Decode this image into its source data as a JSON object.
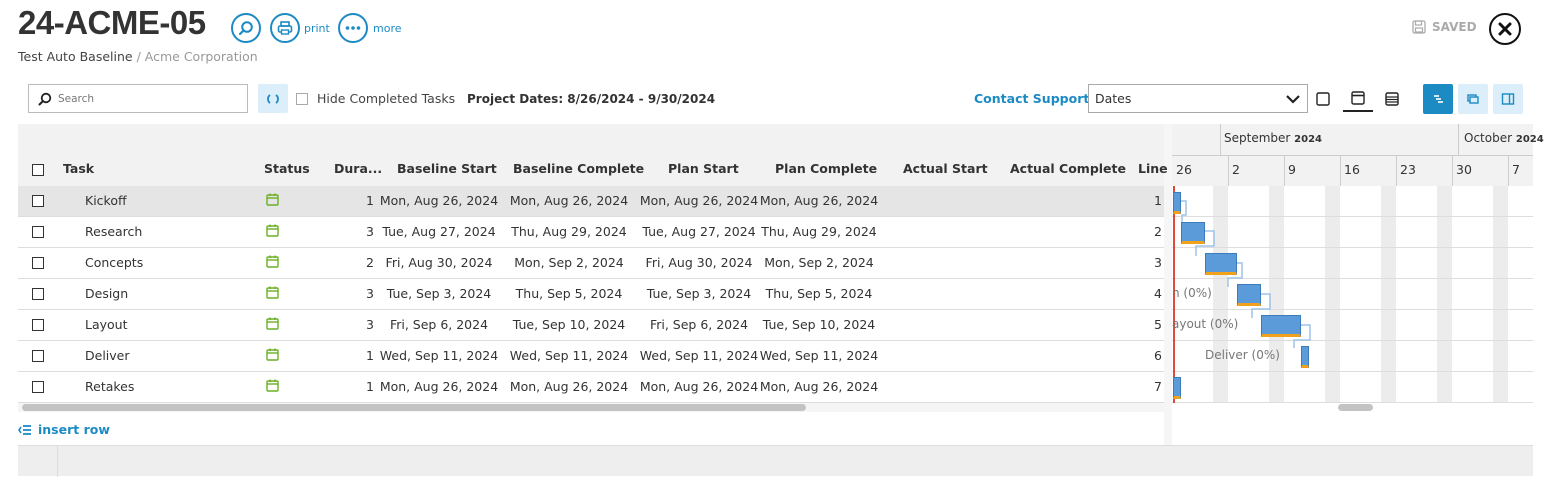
{
  "header": {
    "title": "24-ACME-05",
    "baseline": "Test Auto Baseline",
    "separator": "/",
    "organization": "Acme Corporation",
    "print_label": "print",
    "more_label": "more",
    "saved_label": "SAVED"
  },
  "toolbar": {
    "search_placeholder": "Search",
    "hide_completed_label": "Hide Completed Tasks",
    "project_dates": "Project Dates: 8/26/2024 - 9/30/2024",
    "contact_support": "Contact Support",
    "dates_select_value": "Dates",
    "insert_row": "insert row"
  },
  "columns": [
    "Task",
    "Status",
    "Dura...",
    "Baseline Start",
    "Baseline Complete",
    "Plan Start",
    "Plan Complete",
    "Actual Start",
    "Actual Complete",
    "Line"
  ],
  "rows": [
    {
      "task": "Kickoff",
      "duration": "1",
      "baseline_start": "Mon, Aug 26, 2024",
      "baseline_complete": "Mon, Aug 26, 2024",
      "plan_start": "Mon, Aug 26, 2024",
      "plan_complete": "Mon, Aug 26, 2024",
      "actual_start": "",
      "actual_complete": "",
      "line": "1",
      "selected": true
    },
    {
      "task": "Research",
      "duration": "3",
      "baseline_start": "Tue, Aug 27, 2024",
      "baseline_complete": "Thu, Aug 29, 2024",
      "plan_start": "Tue, Aug 27, 2024",
      "plan_complete": "Thu, Aug 29, 2024",
      "actual_start": "",
      "actual_complete": "",
      "line": "2",
      "selected": false
    },
    {
      "task": "Concepts",
      "duration": "2",
      "baseline_start": "Fri, Aug 30, 2024",
      "baseline_complete": "Mon, Sep 2, 2024",
      "plan_start": "Fri, Aug 30, 2024",
      "plan_complete": "Mon, Sep 2, 2024",
      "actual_start": "",
      "actual_complete": "",
      "line": "3",
      "selected": false
    },
    {
      "task": "Design",
      "duration": "3",
      "baseline_start": "Tue, Sep 3, 2024",
      "baseline_complete": "Thu, Sep 5, 2024",
      "plan_start": "Tue, Sep 3, 2024",
      "plan_complete": "Thu, Sep 5, 2024",
      "actual_start": "",
      "actual_complete": "",
      "line": "4",
      "selected": false
    },
    {
      "task": "Layout",
      "duration": "3",
      "baseline_start": "Fri, Sep 6, 2024",
      "baseline_complete": "Tue, Sep 10, 2024",
      "plan_start": "Fri, Sep 6, 2024",
      "plan_complete": "Tue, Sep 10, 2024",
      "actual_start": "",
      "actual_complete": "",
      "line": "5",
      "selected": false
    },
    {
      "task": "Deliver",
      "duration": "1",
      "baseline_start": "Wed, Sep 11, 2024",
      "baseline_complete": "Wed, Sep 11, 2024",
      "plan_start": "Wed, Sep 11, 2024",
      "plan_complete": "Wed, Sep 11, 2024",
      "actual_start": "",
      "actual_complete": "",
      "line": "6",
      "selected": false
    },
    {
      "task": "Retakes",
      "duration": "1",
      "baseline_start": "Mon, Aug 26, 2024",
      "baseline_complete": "Mon, Aug 26, 2024",
      "plan_start": "Mon, Aug 26, 2024",
      "plan_complete": "Mon, Aug 26, 2024",
      "actual_start": "",
      "actual_complete": "",
      "line": "7",
      "selected": false
    }
  ],
  "gantt": {
    "months": [
      {
        "name": "September",
        "year": "2024"
      },
      {
        "name": "October",
        "year": "2024"
      }
    ],
    "week_days": [
      "26",
      "2",
      "9",
      "16",
      "23",
      "30",
      "7"
    ],
    "bar_labels": [
      "n (0%)",
      "ayout (0%)",
      "Deliver (0%)"
    ]
  },
  "colors": {
    "accent": "#1c8bc4",
    "status_green": "#6ab023",
    "bar_blue": "#5b9bd9",
    "bar_orange": "#f2a11c"
  }
}
